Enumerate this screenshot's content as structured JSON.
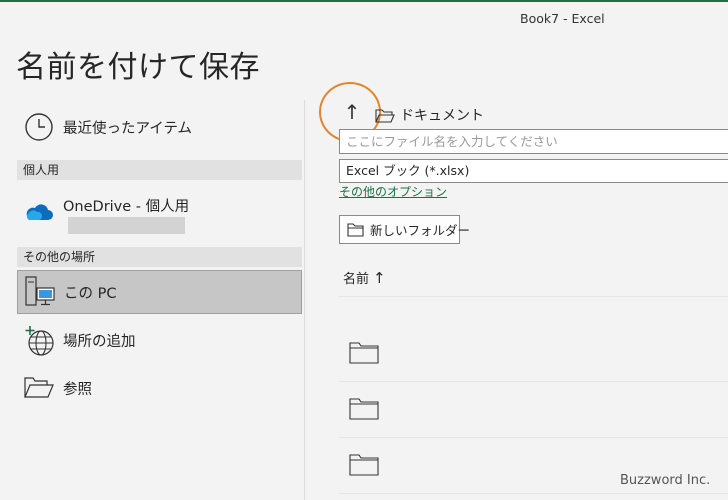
{
  "window_title": "Book7  -  Excel",
  "page_title": "名前を付けて保存",
  "left_nav": {
    "recent": "最近使ったアイテム",
    "section_personal": "個人用",
    "onedrive": "OneDrive - 個人用",
    "section_other": "その他の場所",
    "this_pc": "この PC",
    "add_place": "場所の追加",
    "browse": "参照"
  },
  "main": {
    "path": "ドキュメント",
    "filename_placeholder": "ここにファイル名を入力してください",
    "filetype": "Excel ブック (*.xlsx)",
    "more_options": "その他のオプション",
    "new_folder": "新しいフォルダー",
    "column_name": "名前",
    "sort_arrow": "↑"
  },
  "watermark": "Buzzword Inc.",
  "colors": {
    "accent": "#1e7145",
    "highlight": "#e0862f",
    "selected_bg": "#c6c6c6",
    "onedrive_blue": "#0f6cbd"
  }
}
